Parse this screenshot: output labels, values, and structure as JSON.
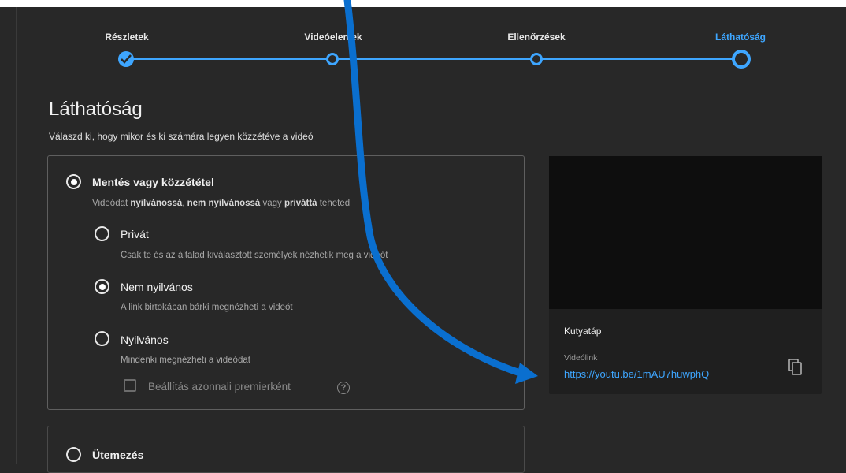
{
  "stepper": {
    "steps": [
      {
        "label": "Részletek",
        "state": "done"
      },
      {
        "label": "Videóelemek",
        "state": "pending"
      },
      {
        "label": "Ellenőrzések",
        "state": "pending"
      },
      {
        "label": "Láthatóság",
        "state": "current"
      }
    ]
  },
  "page": {
    "title": "Láthatóság",
    "subtitle": "Válaszd ki, hogy mikor és ki számára legyen közzétéve a videó"
  },
  "save_publish": {
    "label": "Mentés vagy közzététel",
    "selected": true,
    "desc_prefix": "Videódat ",
    "desc_b1": "nyilvánossá",
    "desc_sep1": ", ",
    "desc_b2": "nem nyilvánossá",
    "desc_mid": " vagy ",
    "desc_b3": "priváttá",
    "desc_suffix": " teheted",
    "options": [
      {
        "label": "Privát",
        "desc": "Csak te és az általad kiválasztott személyek nézhetik meg a videót",
        "selected": false
      },
      {
        "label": "Nem nyilvános",
        "desc": "A link birtokában bárki megnézheti a videót",
        "selected": true
      },
      {
        "label": "Nyilvános",
        "desc": "Mindenki megnézheti a videódat",
        "selected": false
      }
    ],
    "premiere_checkbox": {
      "label": "Beállítás azonnali premierként",
      "checked": false,
      "help": "?"
    }
  },
  "schedule": {
    "label": "Ütemezés",
    "selected": false
  },
  "preview": {
    "video_title": "Kutyatáp",
    "link_label": "Videólink",
    "link": "https://youtu.be/1mAU7huwphQ"
  },
  "colors": {
    "accent": "#3ea6ff",
    "background": "#282828",
    "annotation_arrow": "#0a6fcf"
  },
  "icons": {
    "copy": "copy-icon",
    "check": "check-icon",
    "help": "help-icon"
  }
}
